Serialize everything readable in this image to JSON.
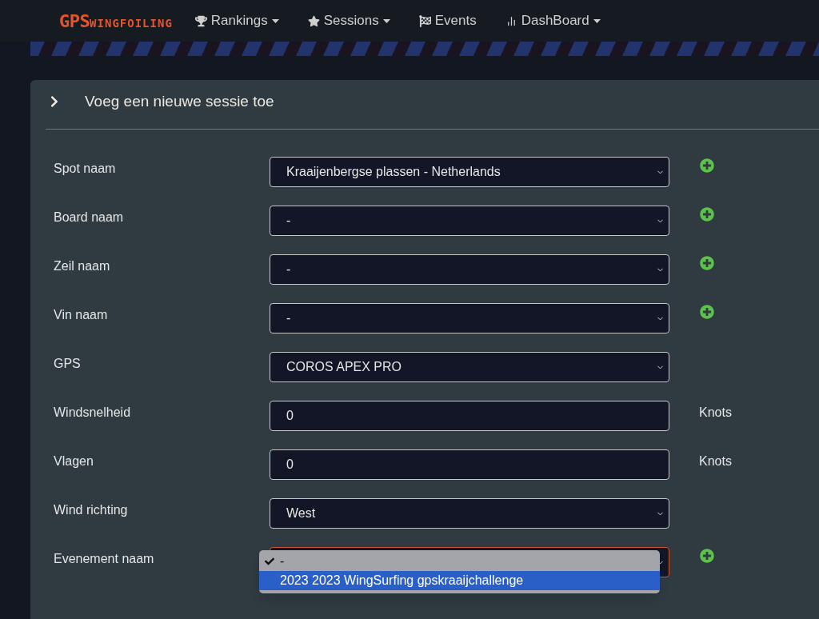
{
  "navbar": {
    "logo": {
      "big": "GPS",
      "small": "WINGFOILING"
    },
    "items": [
      {
        "label": "Rankings",
        "has_menu": true
      },
      {
        "label": "Sessions",
        "has_menu": true
      },
      {
        "label": "Events",
        "has_menu": false
      },
      {
        "label": "DashBoard",
        "has_menu": true
      }
    ]
  },
  "panel": {
    "title": "Voeg een nieuwe sessie toe",
    "fields": [
      {
        "label": "Spot naam",
        "kind": "select",
        "value": "Kraaijenbergse plassen - Netherlands",
        "add_button": true
      },
      {
        "label": "Board naam",
        "kind": "select",
        "value": "-",
        "add_button": true
      },
      {
        "label": "Zeil naam",
        "kind": "select",
        "value": "-",
        "add_button": true
      },
      {
        "label": "Vin naam",
        "kind": "select",
        "value": "-",
        "add_button": true
      },
      {
        "label": "GPS",
        "kind": "select",
        "value": "COROS APEX PRO",
        "add_button": false
      },
      {
        "label": "Windsnelheid",
        "kind": "input",
        "value": "0",
        "unit": "Knots"
      },
      {
        "label": "Vlagen",
        "kind": "input",
        "value": "0",
        "unit": "Knots"
      },
      {
        "label": "Wind richting",
        "kind": "select",
        "value": "West",
        "add_button": false
      },
      {
        "label": "Evenement naam",
        "kind": "select",
        "focused": true,
        "add_button": true,
        "options": [
          {
            "label": "-",
            "checked": true,
            "highlighted": false
          },
          {
            "label": "2023 2023 WingSurfing gpskraaijchallenge",
            "checked": false,
            "highlighted": true
          }
        ]
      }
    ]
  }
}
